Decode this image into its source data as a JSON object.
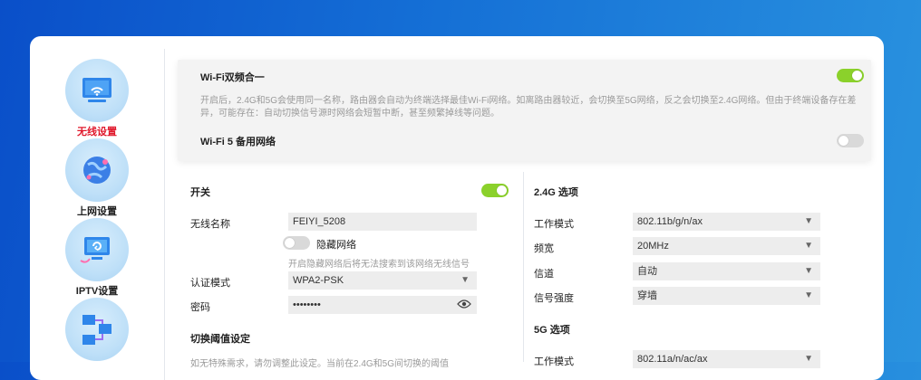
{
  "sidebar": {
    "items": [
      {
        "label": "无线设置",
        "icon": "wireless-screen-icon"
      },
      {
        "label": "上网设置",
        "icon": "globe-icon"
      },
      {
        "label": "IPTV设置",
        "icon": "tv-icon"
      },
      {
        "label": "",
        "icon": "network-topology-icon"
      }
    ]
  },
  "dual_band": {
    "title": "Wi-Fi双频合一",
    "description": "开启后，2.4G和5G会使用同一名称，路由器会自动为终端选择最佳Wi-Fi网络。如离路由器较近，会切换至5G网络，反之会切换至2.4G网络。但由于终端设备存在差异，可能存在：自动切换信号源时网络会短暂中断，甚至频繁掉线等问题。",
    "toggle_on": true,
    "wifi5_label": "Wi-Fi 5 备用网络",
    "wifi5_toggle_on": false
  },
  "wifi": {
    "switch_label": "开关",
    "switch_on": true,
    "ssid_label": "无线名称",
    "ssid_value": "FEIYI_5208",
    "hide_label": "隐藏网络",
    "hide_hint": "开启隐藏网络后将无法搜索到该网络无线信号",
    "auth_label": "认证模式",
    "auth_value": "WPA2-PSK",
    "password_label": "密码",
    "password_value": "••••••••",
    "threshold_title": "切换阈值设定",
    "threshold_desc": "如无特殊需求，请勿调整此设定。当前在2.4G和5G间切换的阈值"
  },
  "band24": {
    "title": "2.4G 选项",
    "mode_label": "工作模式",
    "mode_value": "802.11b/g/n/ax",
    "width_label": "频宽",
    "width_value": "20MHz",
    "channel_label": "信道",
    "channel_value": "自动",
    "strength_label": "信号强度",
    "strength_value": "穿墙"
  },
  "band5": {
    "title": "5G 选项",
    "mode_label": "工作模式",
    "mode_value": "802.11a/n/ac/ax"
  },
  "colors": {
    "accent_green": "#8bd12b",
    "active_red": "#e0182b"
  }
}
